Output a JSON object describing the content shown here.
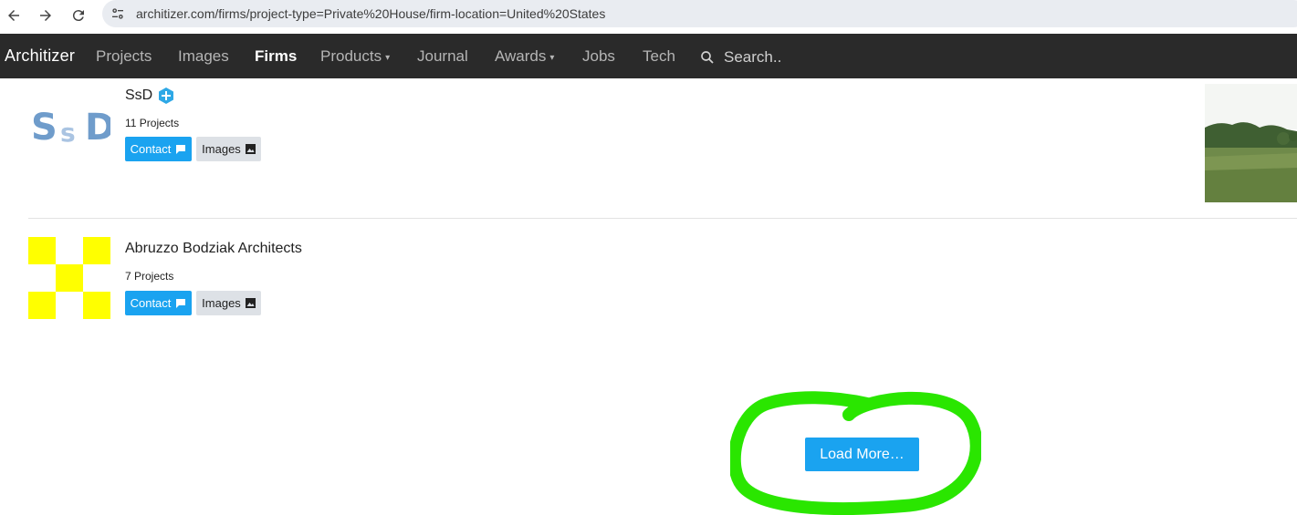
{
  "browser": {
    "back_icon": "arrow-left-icon",
    "forward_icon": "arrow-right-icon",
    "reload_icon": "reload-icon",
    "site_info_icon": "tune-icon",
    "url": "architizer.com/firms/project-type=Private%20House/firm-location=United%20States"
  },
  "site_nav": {
    "logo": "Architizer",
    "items": [
      {
        "label": "Projects"
      },
      {
        "label": "Images"
      },
      {
        "label": "Firms",
        "active": true
      },
      {
        "label": "Products",
        "has_caret": true
      },
      {
        "label": "Journal"
      },
      {
        "label": "Awards",
        "has_caret": true
      },
      {
        "label": "Jobs"
      },
      {
        "label": "Tech"
      }
    ],
    "caret": "▾",
    "search_placeholder": "Search.."
  },
  "firms": [
    {
      "logo_text": [
        "S",
        "s",
        "D"
      ],
      "name": "SsD",
      "badge_icon": "plus-hexagon-icon",
      "projects": "11 Projects",
      "contact_label": "Contact",
      "images_label": "Images"
    },
    {
      "name": "Abruzzo Bodziak Architects",
      "projects": "7 Projects",
      "contact_label": "Contact",
      "images_label": "Images"
    }
  ],
  "load_more_label": "Load More…",
  "colors": {
    "nav_bg": "#2a2a2a",
    "accent": "#1aa3f0",
    "highlight": "#2ae600",
    "ssd_logo": "#6f9ccb",
    "checker": "#ffff00"
  }
}
